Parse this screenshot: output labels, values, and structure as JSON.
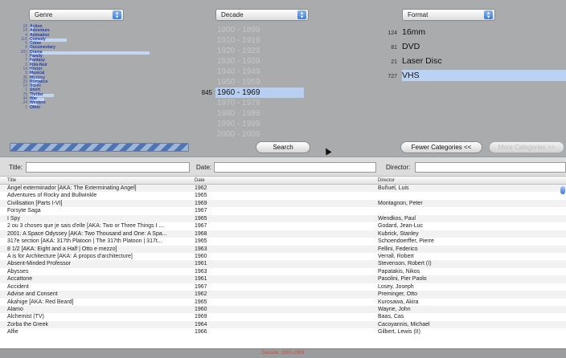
{
  "popups": {
    "genre": "Genre",
    "decade": "Decade",
    "format": "Format"
  },
  "genres": [
    {
      "count": "18",
      "name": "Action",
      "fill": 0.03
    },
    {
      "count": "14",
      "name": "Adventure",
      "fill": 0.02
    },
    {
      "count": "4",
      "name": "Animation",
      "fill": 0.01
    },
    {
      "count": "116",
      "name": "Comedy",
      "fill": 0.26
    },
    {
      "count": "6",
      "name": "Crime",
      "fill": 0.01
    },
    {
      "count": "4",
      "name": "Documentary",
      "fill": 0.01
    },
    {
      "count": "397",
      "name": "Drama",
      "fill": 0.85
    },
    {
      "count": "7",
      "name": "Family",
      "fill": 0.02
    },
    {
      "count": "7",
      "name": "Fantasy",
      "fill": 0.02
    },
    {
      "count": "3",
      "name": "Film-Noir",
      "fill": 0.01
    },
    {
      "count": "14",
      "name": "Horror",
      "fill": 0.03
    },
    {
      "count": "9",
      "name": "Musical",
      "fill": 0.02
    },
    {
      "count": "36",
      "name": "Mystery",
      "fill": 0.08
    },
    {
      "count": "29",
      "name": "Romance",
      "fill": 0.07
    },
    {
      "count": "14",
      "name": "Sci-Fi",
      "fill": 0.03
    },
    {
      "count": "1",
      "name": "Short",
      "fill": 0.0
    },
    {
      "count": "75",
      "name": "Thriller",
      "fill": 0.17
    },
    {
      "count": "44",
      "name": "War",
      "fill": 0.1
    },
    {
      "count": "24",
      "name": "Western",
      "fill": 0.05
    },
    {
      "count": "1",
      "name": "Other",
      "fill": 0.0
    }
  ],
  "decades": [
    {
      "count": "",
      "label": "1800 - 1899",
      "active": false
    },
    {
      "count": "",
      "label": "1910 - 1919",
      "active": false
    },
    {
      "count": "",
      "label": "1920 - 1929",
      "active": false
    },
    {
      "count": "",
      "label": "1930 - 1939",
      "active": false
    },
    {
      "count": "",
      "label": "1940 - 1949",
      "active": false
    },
    {
      "count": "",
      "label": "1950 - 1959",
      "active": false
    },
    {
      "count": "845",
      "label": "1960 - 1969",
      "active": true
    },
    {
      "count": "",
      "label": "1970 - 1979",
      "active": false
    },
    {
      "count": "",
      "label": "1980 - 1989",
      "active": false
    },
    {
      "count": "",
      "label": "1990 - 1999",
      "active": false
    },
    {
      "count": "",
      "label": "2000 - 2009",
      "active": false
    }
  ],
  "formats": [
    {
      "count": "124",
      "label": "16mm",
      "fill": 0.0
    },
    {
      "count": "81",
      "label": "DVD",
      "fill": 0.0
    },
    {
      "count": "21",
      "label": "Laser Disc",
      "fill": 0.0
    },
    {
      "count": "727",
      "label": "VHS",
      "fill": 1.0
    }
  ],
  "buttons": {
    "search": "Search",
    "fewer": "Fewer Categories <<",
    "more": "More Categories >>"
  },
  "filters": {
    "title_label": "Title:",
    "date_label": "Date:",
    "director_label": "Director:"
  },
  "table": {
    "headers": {
      "title": "Title",
      "date": "Date",
      "director": "Director"
    },
    "rows": [
      {
        "title": "Ángel exterminador [AKA: The Exterminating Angel]",
        "date": "1962",
        "director": "Buñuel, Luis"
      },
      {
        "title": "Adventures of Rocky and Bullwinkle",
        "date": "1965",
        "director": ""
      },
      {
        "title": "Civilisation [Parts I-VI]",
        "date": "1969",
        "director": "Montagnon, Peter"
      },
      {
        "title": "Forsyte Saga",
        "date": "1967",
        "director": ""
      },
      {
        "title": "I Spy",
        "date": "1965",
        "director": "Wendkos, Paul"
      },
      {
        "title": "2 ou 3 choses que je sais d'elle [AKA: Two or Three Things I ...",
        "date": "1967",
        "director": "Godard, Jean-Luc"
      },
      {
        "title": "2001: A Space Odyssey [AKA: Two Thousand and One: A Spa...",
        "date": "1968",
        "director": "Kubrick, Stanley"
      },
      {
        "title": "317e section [AKA: 317th Platoon | The 317th Platoon | 317t...",
        "date": "1965",
        "director": "Schoendoerffer, Pierre"
      },
      {
        "title": "8 1/2 [AKA: Eight and a Half | Otto e mezzo]",
        "date": "1963",
        "director": "Fellini, Federico"
      },
      {
        "title": "A is for Architecture [AKA: À propos d'architecture]",
        "date": "1960",
        "director": "Verrall, Robert"
      },
      {
        "title": "Absent-Minded Professor",
        "date": "1961",
        "director": "Stevenson, Robert (I)"
      },
      {
        "title": "Abysses",
        "date": "1963",
        "director": "Papatakis, Nikos"
      },
      {
        "title": "Accattone",
        "date": "1961",
        "director": "Pasolini, Pier Paolo"
      },
      {
        "title": "Accident",
        "date": "1967",
        "director": "Losey, Joseph"
      },
      {
        "title": "Advise and Consent",
        "date": "1962",
        "director": "Preminger, Otto"
      },
      {
        "title": "Akahige [AKA: Red Beard]",
        "date": "1965",
        "director": "Kurosawa, Akira"
      },
      {
        "title": "Alamo",
        "date": "1960",
        "director": "Wayne, John"
      },
      {
        "title": "Alchemist (TV)",
        "date": "1969",
        "director": "Baas, Cas"
      },
      {
        "title": "Zorba the Greek",
        "date": "1964",
        "director": "Cacoyannis, Michael"
      },
      {
        "title": "Alfie",
        "date": "1966",
        "director": "Gilbert, Lewis (II)"
      }
    ]
  },
  "status": "Decade: 1960-1969",
  "colors": {
    "panel": "#a9abad",
    "selection": "#b9cff2",
    "genre_text": "#1e3fb4",
    "status_text": "#d24a3a"
  }
}
